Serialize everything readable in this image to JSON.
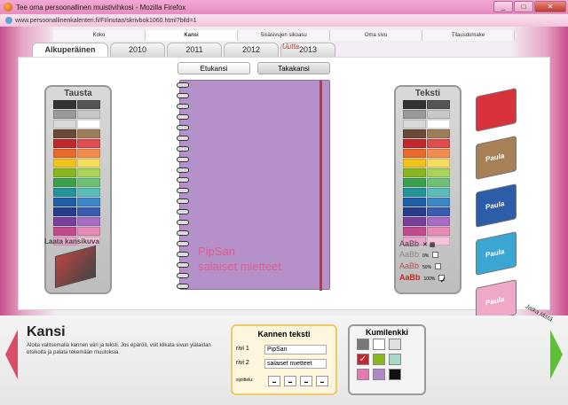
{
  "window": {
    "title": "Tee oma persoonallinen muistivihkosi - Mozilla Firefox",
    "url": "www.persoonallinenkalenteri.fi/FI/inutan/skrivbok1060.html?bild=1",
    "buttons": [
      "_",
      "□",
      "✕"
    ]
  },
  "topnav": [
    "Koko",
    "Kansi",
    "Sisäsivujen sikoasu",
    "Oma sivu",
    "Tilausdomake"
  ],
  "years": {
    "items": [
      "Alkuperäinen",
      "2010",
      "2011",
      "2012",
      "2013"
    ],
    "active": "Alkuperäinen",
    "new_label": "Uutta"
  },
  "side_buttons": {
    "front": "Etukansi",
    "back": "Takakansi"
  },
  "background_palette": {
    "title": "Tausta",
    "colors": [
      "#333333",
      "#555555",
      "#999999",
      "#c8c8c8",
      "#d9d9d9",
      "#ffffff",
      "#6b4a3a",
      "#9e7d5a",
      "#c0282b",
      "#e04b4b",
      "#e8692c",
      "#f28c4f",
      "#f3c21a",
      "#f5dc5a",
      "#86b71f",
      "#a8d45a",
      "#3aa04a",
      "#6cc175",
      "#25939a",
      "#5bbdb8",
      "#1e5fa9",
      "#3b87c8",
      "#283c8c",
      "#3a5cb0",
      "#7a3e9c",
      "#a86cc4",
      "#c14a8e",
      "#e68bb8",
      "#e9a4c9",
      "#f5c4da"
    ]
  },
  "text_palette": {
    "title": "Teksti",
    "colors": [
      "#333333",
      "#555555",
      "#999999",
      "#c8c8c8",
      "#d9d9d9",
      "#ffffff",
      "#6b4a3a",
      "#9e7d5a",
      "#c0282b",
      "#e04b4b",
      "#e8692c",
      "#f28c4f",
      "#f3c21a",
      "#f5dc5a",
      "#86b71f",
      "#a8d45a",
      "#3aa04a",
      "#6cc175",
      "#25939a",
      "#5bbdb8",
      "#1e5fa9",
      "#3b87c8",
      "#283c8c",
      "#3a5cb0",
      "#7a3e9c",
      "#a86cc4",
      "#c14a8e",
      "#e68bb8",
      "#e9a4c9",
      "#f5c4da"
    ]
  },
  "cover_image_label": "Laata kansikuva",
  "notebook": {
    "line1": "PipSan",
    "line2": "salaiset mietteet",
    "color": "#b491c8",
    "band": "#b33b4f",
    "text_color": "#e15d8c"
  },
  "text_styles": [
    {
      "sample": "AaBb",
      "pct": ""
    },
    {
      "sample": "AaBb",
      "pct": "0%"
    },
    {
      "sample": "AaBb",
      "pct": "50%"
    },
    {
      "sample": "AaBb",
      "pct": "100%"
    }
  ],
  "thumbnails": [
    {
      "color": "#d8323a",
      "label": ""
    },
    {
      "color": "#a88055",
      "label": "Paula"
    },
    {
      "color": "#2d5ca8",
      "label": "Paula"
    },
    {
      "color": "#3aa6d4",
      "label": "Paula"
    },
    {
      "color": "#f0a8c8",
      "label": "Paula"
    }
  ],
  "bottom": {
    "title": "Kansi",
    "description": "Aloita valitsemalla kannen väri ja teksti. Jos epäröit, voit klikata sivun ylälaidan otsikoita ja palata tekemään muutoksia.",
    "kannen_teksti": {
      "title": "Kannen teksti",
      "row1_label": "rivi 1",
      "row1_value": "PipSan",
      "row2_label": "rivi 2",
      "row2_value": "salaiset mietteet",
      "placement_label": "sijoittelu:"
    },
    "kumilenkki": {
      "title": "Kumilenkki",
      "colors": [
        "#777777",
        "#ffffff",
        "#e0e0e0",
        "#c0282b",
        "#86b71f",
        "#a8d8c8",
        "#e878b0",
        "#b088c8",
        "#111111"
      ],
      "selected": 3
    },
    "continue_label": "Jatka tästä"
  }
}
